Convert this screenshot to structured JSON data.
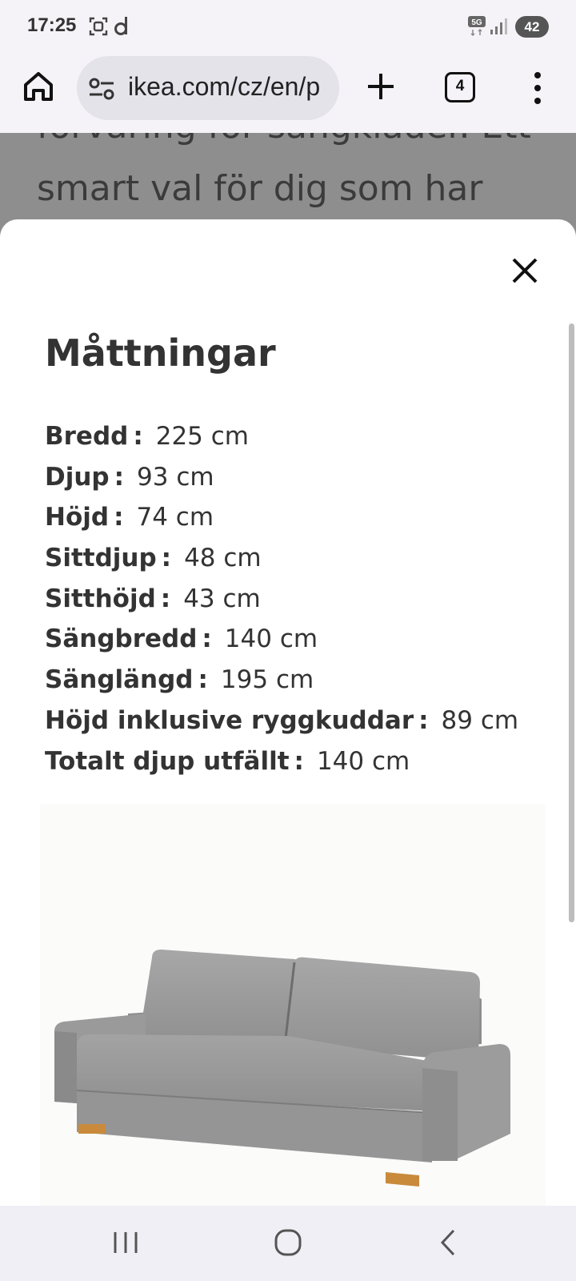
{
  "status_bar": {
    "time": "17:25",
    "battery": "42",
    "network": "5G"
  },
  "browser": {
    "url": "ikea.com/cz/en/p",
    "tab_count": "4"
  },
  "background_page": {
    "line1": "förvaring för sängkläder. Ett",
    "line2": "smart val för dig som har"
  },
  "modal": {
    "title": "Måttningar",
    "dimensions": [
      {
        "label": "Bredd",
        "value": "225 cm"
      },
      {
        "label": "Djup",
        "value": "93 cm"
      },
      {
        "label": "Höjd",
        "value": "74 cm"
      },
      {
        "label": "Sittdjup",
        "value": "48 cm"
      },
      {
        "label": "Sitthöjd",
        "value": "43 cm"
      },
      {
        "label": "Sängbredd",
        "value": "140 cm"
      },
      {
        "label": "Sänglängd",
        "value": "195 cm"
      },
      {
        "label": "Höjd inklusive ryggkuddar",
        "value": "89 cm"
      },
      {
        "label": "Totalt djup utfällt",
        "value": "140 cm"
      }
    ],
    "separator": ":"
  },
  "colors": {
    "sofa_fabric": "#9c9c9c",
    "sofa_legs": "#c98a3c",
    "dim_overlay": "#8e8e8e"
  }
}
